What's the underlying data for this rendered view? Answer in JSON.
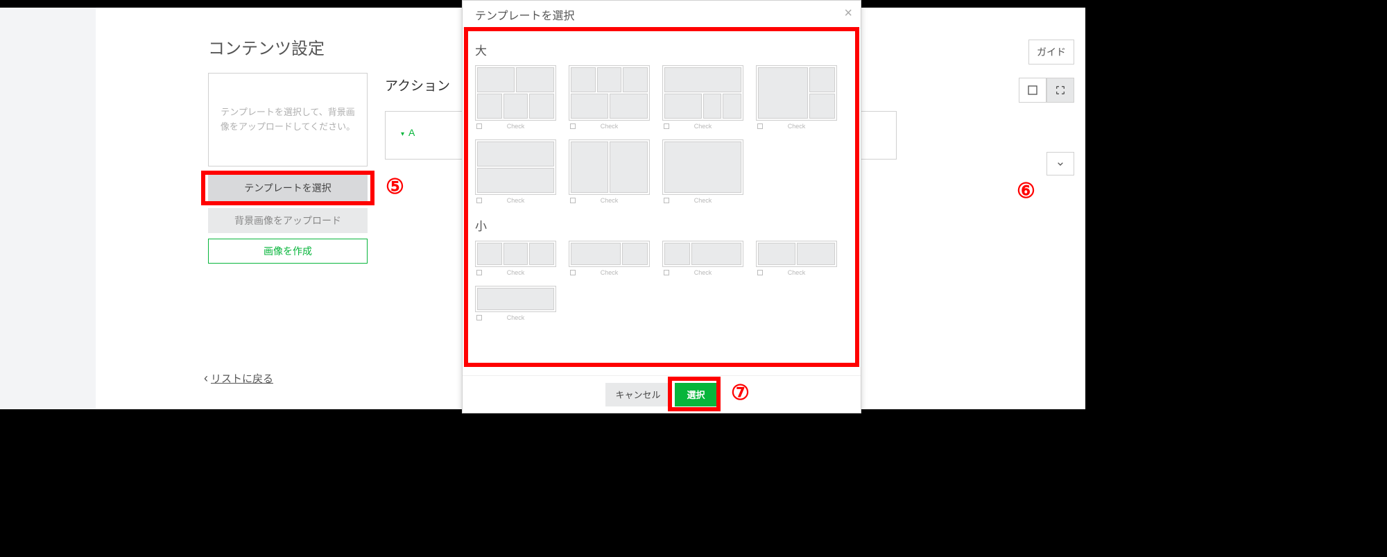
{
  "page": {
    "section_title": "コンテンツ設定",
    "template_placeholder": "テンプレートを選択して、背景画像をアップロードしてください。",
    "select_template_btn": "テンプレートを選択",
    "upload_bg_btn": "背景画像をアップロード",
    "create_image_btn": "画像を作成",
    "action_label": "アクション",
    "action_item": "A",
    "guide_btn": "ガイド",
    "back_link": "リストに戻る"
  },
  "modal": {
    "title": "テンプレートを選択",
    "category_large": "大",
    "category_small": "小",
    "cancel": "キャンセル",
    "select": "選択",
    "thumb_meta": "Check",
    "templates_large": [
      {
        "layout": "l1",
        "panes": 5
      },
      {
        "layout": "l2",
        "panes": 5
      },
      {
        "layout": "l3",
        "panes": 4
      },
      {
        "layout": "l4",
        "panes": 3
      },
      {
        "layout": "l5",
        "panes": 2
      },
      {
        "layout": "l6",
        "panes": 2
      },
      {
        "layout": "l7",
        "panes": 1
      }
    ],
    "templates_small": [
      {
        "layout": "s1",
        "panes": 3
      },
      {
        "layout": "s2",
        "panes": 2
      },
      {
        "layout": "s3",
        "panes": 2
      },
      {
        "layout": "s4",
        "panes": 2
      },
      {
        "layout": "s5",
        "panes": 1
      }
    ]
  },
  "callouts": {
    "five": "⑤",
    "six": "⑥",
    "seven": "⑦"
  }
}
